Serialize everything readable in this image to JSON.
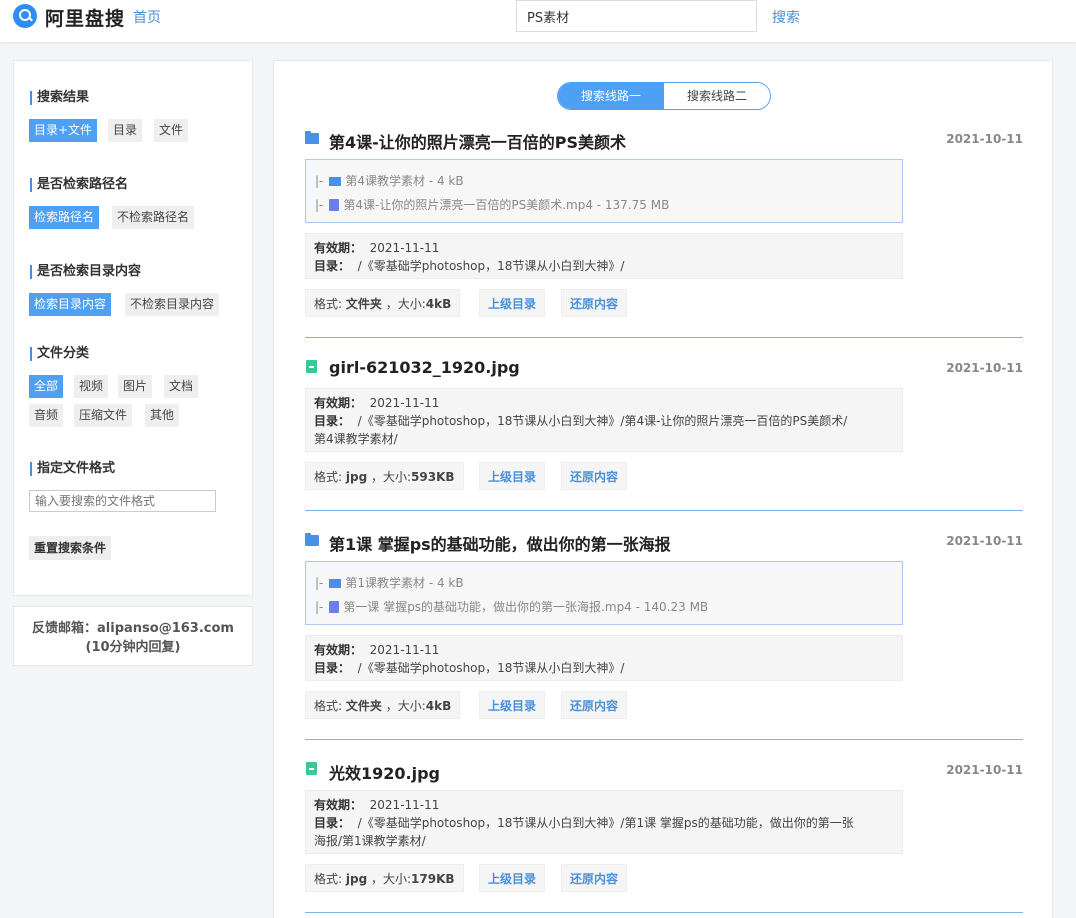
{
  "header": {
    "app_name": "阿里盘搜",
    "home_label": "首页",
    "search_value": "PS素材",
    "search_button": "搜索"
  },
  "sidebar": {
    "sections": [
      {
        "title": "搜索结果",
        "options": [
          "目录+文件",
          "目录",
          "文件"
        ],
        "active": 0
      },
      {
        "title": "是否检索路径名",
        "options": [
          "检索路径名",
          "不检索路径名"
        ],
        "active": 0
      },
      {
        "title": "是否检索目录内容",
        "options": [
          "检索目录内容",
          "不检索目录内容"
        ],
        "active": 0
      },
      {
        "title": "文件分类",
        "options": [
          "全部",
          "视频",
          "图片",
          "文档",
          "音频",
          "压缩文件",
          "其他"
        ],
        "active": 0
      }
    ],
    "format_title": "指定文件格式",
    "format_placeholder": "输入要搜索的文件格式",
    "reset_label": "重置搜索条件",
    "feedback_line1": "反馈邮箱：alipanso@163.com",
    "feedback_line2": "(10分钟内回复)"
  },
  "main": {
    "route_tabs": [
      "搜索线路一",
      "搜索线路二"
    ],
    "active_route": 0,
    "labels": {
      "validity": "有效期：",
      "directory": "目录：",
      "format": "格式:",
      "size": "，大小:",
      "parent_dir": "上级目录",
      "restore": "还原内容"
    },
    "results": [
      {
        "type": "folder",
        "title": "第4课-让你的照片漂亮一百倍的PS美颜术",
        "date": "2021-10-11",
        "files": [
          {
            "kind": "folder",
            "text": "第4课教学素材  - 4 kB"
          },
          {
            "kind": "video",
            "text": "第4课-让你的照片漂亮一百倍的PS美颜术.mp4  - 137.75 MB"
          }
        ],
        "validity": "2021-11-11",
        "directory_line1": "/《零基础学photoshop，18节课从小白到大神》/",
        "directory_line2": "",
        "format": "文件夹",
        "size": "4kB"
      },
      {
        "type": "file",
        "title": "girl-621032_1920.jpg",
        "date": "2021-10-11",
        "files": [],
        "validity": "2021-11-11",
        "directory_line1": "/《零基础学photoshop，18节课从小白到大神》/第4课-让你的照片漂亮一百倍的PS美颜术/",
        "directory_line2": "第4课教学素材/",
        "format": "jpg",
        "size": "593KB"
      },
      {
        "type": "folder",
        "title": "第1课 掌握ps的基础功能，做出你的第一张海报",
        "date": "2021-10-11",
        "files": [
          {
            "kind": "folder",
            "text": "第1课教学素材  - 4 kB"
          },
          {
            "kind": "video",
            "text": "第一课 掌握ps的基础功能，做出你的第一张海报.mp4  - 140.23 MB"
          }
        ],
        "validity": "2021-11-11",
        "directory_line1": "/《零基础学photoshop，18节课从小白到大神》/",
        "directory_line2": "",
        "format": "文件夹",
        "size": "4kB"
      },
      {
        "type": "file",
        "title": "光效1920.jpg",
        "date": "2021-10-11",
        "files": [],
        "validity": "2021-11-11",
        "directory_line1": "/《零基础学photoshop，18节课从小白到大神》/第1课 掌握ps的基础功能，做出你的第一张",
        "directory_line2": "海报/第1课教学素材/",
        "format": "jpg",
        "size": "179KB"
      }
    ]
  }
}
